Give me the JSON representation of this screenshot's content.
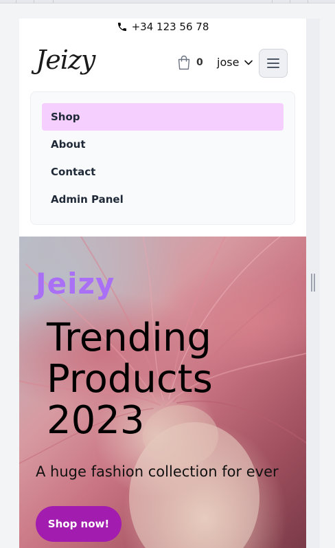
{
  "topbar": {
    "phone": "+34 123 56 78",
    "phone_icon": "phone-icon"
  },
  "header": {
    "logo": "Jeizy",
    "cart_count": "0",
    "cart_icon": "shopping-bag-icon",
    "username": "jose",
    "user_icon": "chevron-down-icon",
    "menu_icon": "hamburger-menu-icon"
  },
  "nav": {
    "items": [
      {
        "label": "Shop",
        "active": true
      },
      {
        "label": "About",
        "active": false
      },
      {
        "label": "Contact",
        "active": false
      },
      {
        "label": "Admin Panel",
        "active": false
      }
    ],
    "active_color": "#f5d0fe"
  },
  "hero": {
    "brand": "Jeizy",
    "title": "Trending Products 2023",
    "subtitle": "A huge fashion collection for ever",
    "cta_label": "Shop now!",
    "brand_color": "#a970f5",
    "cta_color": "#a21caf"
  }
}
